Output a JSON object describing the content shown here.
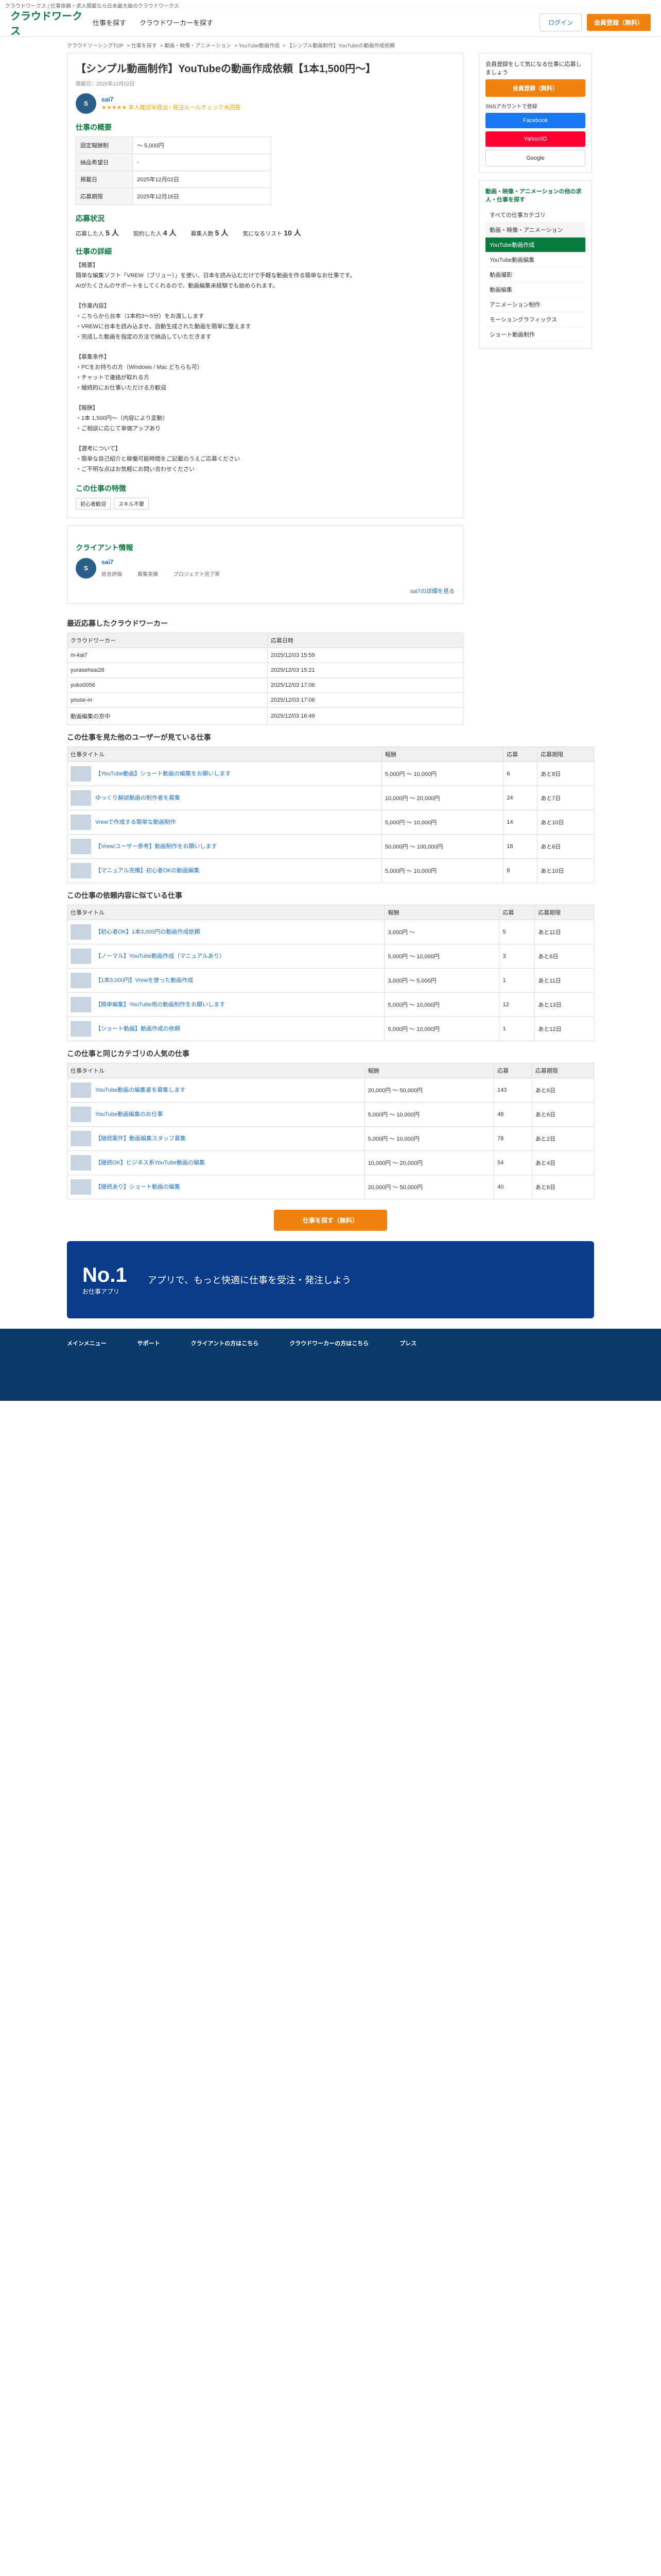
{
  "topbar": {
    "text": "クラウドワークス | 仕事依頼・求人掲載なら日本最大級のクラウドワークス"
  },
  "header": {
    "logo": "クラウドワークス",
    "nav": [
      "仕事を探す",
      "クラウドワーカーを探す"
    ],
    "login": "ログイン",
    "register": "会員登録（無料）"
  },
  "breadcrumb": [
    "クラウドソーシングTOP",
    "仕事を探す",
    "動画・映像・アニメーション",
    "YouTube動画作成",
    "【シンプル動画制作】YouTubeの動画作成依頼"
  ],
  "job": {
    "title": "【シンプル動画制作】YouTubeの動画作成依頼【1本1,500円〜】",
    "meta": "掲載日：2025年12月02日",
    "client_name": "sai7",
    "client_rating": "★★★★★ 本人確認未提出 / 発注ルールチェック未回答",
    "overview_title": "仕事の概要",
    "overview": [
      {
        "k": "固定報酬制",
        "v": "〜 5,000円"
      },
      {
        "k": "納品希望日",
        "v": "-"
      },
      {
        "k": "掲載日",
        "v": "2025年12月02日"
      },
      {
        "k": "応募期限",
        "v": "2025年12月16日"
      }
    ],
    "status_title": "応募状況",
    "status": [
      {
        "k": "応募した人",
        "v": "5 人"
      },
      {
        "k": "契約した人",
        "v": "4 人"
      },
      {
        "k": "募集人数",
        "v": "5 人"
      },
      {
        "k": "気になるリスト",
        "v": "10 人"
      }
    ],
    "detail_title": "仕事の詳細",
    "detail": "【概要】\n簡単な編集ソフト「VREW（ブリュー）」を使い、日本を読み込むだけで手軽な動画を作る簡単なお仕事です。\nAIがたくさんのサポートをしてくれるので、動画編集未経験でも始められます。\n\n【作業内容】\n・こちらから台本（1本約3〜5分）をお渡しします\n・VREWに台本を読み込ませ、自動生成された動画を簡単に整えます\n・完成した動画を指定の方法で納品していただきます\n\n【募集条件】\n・PCをお持ちの方（Windows / Mac どちらも可）\n・チャットで連絡が取れる方\n・継続的にお仕事いただける方歓迎\n\n【報酬】\n・1本 1,500円〜（内容により変動）\n・ご相談に応じて単価アップあり\n\n【選考について】\n・簡単な自己紹介と稼働可能時間をご記載のうえご応募ください\n・ご不明な点はお気軽にお問い合わせください",
    "tags_title": "この仕事の特徴",
    "tags": [
      "初心者歓迎",
      "スキル不要"
    ]
  },
  "client_info": {
    "title": "クライアント情報",
    "name": "sai7",
    "stat1": "総合評価",
    "stat2": "募集実績",
    "stat3": "プロジェクト完了率",
    "link": "sai7の詳細を見る"
  },
  "recent": {
    "title": "最近応募したクラウドワーカー",
    "col1": "クラウドワーカー",
    "col2": "応募日時",
    "rows": [
      [
        "m-kai7",
        "2025/12/03 15:59"
      ],
      [
        "yurasehsai28",
        "2025/12/03 15:21"
      ],
      [
        "yuko0056",
        "2025/12/03 17:06"
      ],
      [
        "youse-m",
        "2025/12/03 17:06"
      ],
      [
        "動画編集の京中",
        "2025/12/03 16:49"
      ]
    ]
  },
  "related1": {
    "title": "この仕事を見た他のユーザーが見ている仕事",
    "cols": [
      "仕事タイトル",
      "報酬",
      "応募",
      "応募期限"
    ],
    "rows": [
      [
        "【YouTube動画】ショート動画の編集をお願いします",
        "5,000円 〜 10,000円",
        "6",
        "あと8日"
      ],
      [
        "ゆっくり解説動画の制作者を募集",
        "10,000円 〜 20,000円",
        "24",
        "あと7日"
      ],
      [
        "Vrewで作成する簡単な動画制作",
        "5,000円 〜 10,000円",
        "14",
        "あと10日"
      ],
      [
        "【Vrew/ユーザー参考】動画制作をお願いします",
        "50,000円 〜 100,000円",
        "18",
        "あと6日"
      ],
      [
        "【マニュアル完備】初心者OKの動画編集",
        "5,000円 〜 10,000円",
        "8",
        "あと10日"
      ]
    ]
  },
  "related2": {
    "title": "この仕事の依頼内容に似ている仕事",
    "cols": [
      "仕事タイトル",
      "報酬",
      "応募",
      "応募期限"
    ],
    "rows": [
      [
        "【初心者OK】1本3,000円の動画作成依頼",
        "3,000円 〜",
        "5",
        "あと11日"
      ],
      [
        "【ノーマル】YouTube動画作成（マニュアルあり）",
        "5,000円 〜 10,000円",
        "3",
        "あと6日"
      ],
      [
        "【1本3,000円】Vrewを使った動画作成",
        "3,000円 〜 5,000円",
        "1",
        "あと11日"
      ],
      [
        "【簡単編集】YouTube用の動画制作をお願いします",
        "5,000円 〜 10,000円",
        "12",
        "あと13日"
      ],
      [
        "【ショート動画】動画作成の依頼",
        "5,000円 〜 10,000円",
        "1",
        "あと12日"
      ]
    ]
  },
  "related3": {
    "title": "この仕事と同じカテゴリの人気の仕事",
    "cols": [
      "仕事タイトル",
      "報酬",
      "応募",
      "応募期限"
    ],
    "rows": [
      [
        "YouTube動画の編集者を募集します",
        "20,000円 〜 50,000円",
        "143",
        "あと6日"
      ],
      [
        "YouTube動画編集のお仕事",
        "5,000円 〜 10,000円",
        "48",
        "あと6日"
      ],
      [
        "【継続案件】動画編集スタッフ募集",
        "5,000円 〜 10,000円",
        "78",
        "あと2日"
      ],
      [
        "【継続OK】ビジネス系YouTube動画の編集",
        "10,000円 〜 20,000円",
        "54",
        "あと4日"
      ],
      [
        "【継続あり】ショート動画の編集",
        "20,000円 〜 50,000円",
        "40",
        "あと6日"
      ]
    ]
  },
  "more_btn": "仕事を探す（無料）",
  "app": {
    "no1": "No.1",
    "sub": "お仕事アプリ",
    "text": "アプリで、もっと快適に仕事を受注・発注しよう"
  },
  "side": {
    "reg_text": "会員登録をして気になる仕事に応募しましょう",
    "reg_btn": "会員登録（無料）",
    "sns_label": "SNSアカウントで登録",
    "fb": "Facebook",
    "y": "Yahoo!ID",
    "g": "Google",
    "cat_title": "動画・映像・アニメーションの他の求人・仕事を探す",
    "cats": [
      "すべての仕事カテゴリ",
      "動画・映像・アニメーション",
      "YouTube動画作成",
      "YouTube動画編集",
      "動画撮影",
      "動画編集",
      "アニメーション制作",
      "モーショングラフィックス",
      "ショート動画制作"
    ]
  },
  "footer": {
    "cols": [
      "メインメニュー",
      "サポート",
      "クライアントの方はこちら",
      "クラウドワーカーの方はこちら",
      "プレス"
    ]
  }
}
